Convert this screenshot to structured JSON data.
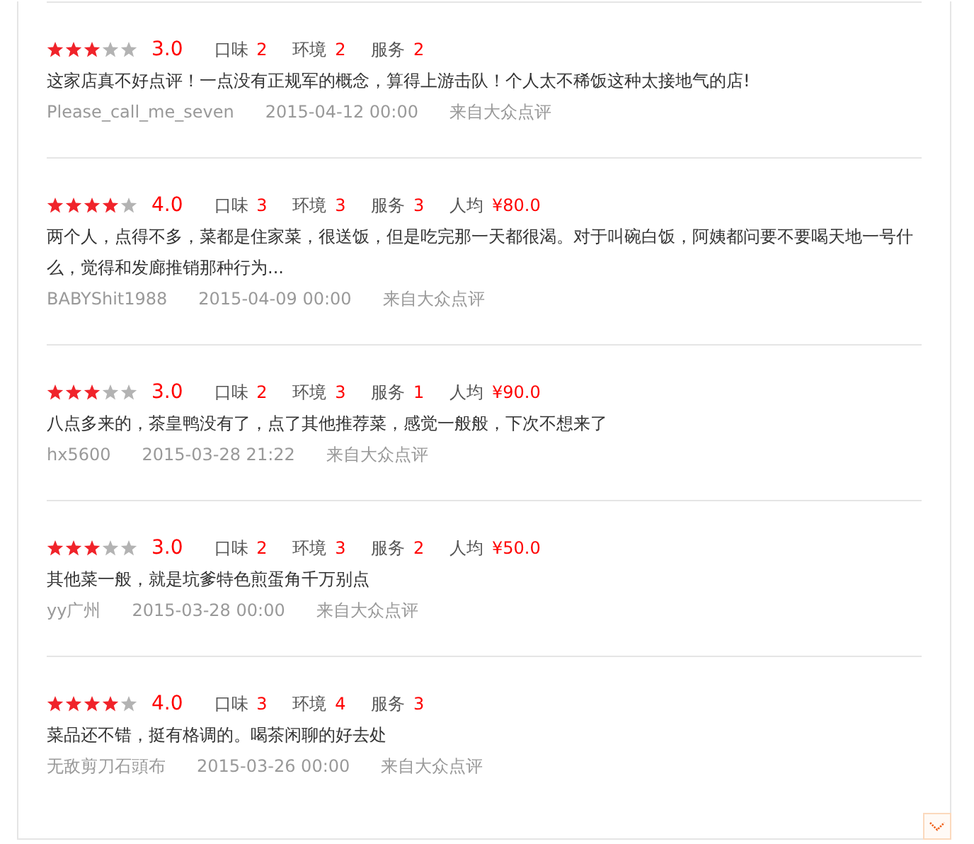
{
  "reviews": [
    {
      "stars": 3,
      "score": "3.0",
      "ratings": [
        {
          "label": "口味",
          "value": "2"
        },
        {
          "label": "环境",
          "value": "2"
        },
        {
          "label": "服务",
          "value": "2"
        }
      ],
      "text": "这家店真不好点评！一点没有正规军的概念，算得上游击队！个人太不稀饭这种太接地气的店!",
      "user": "Please_call_me_seven",
      "time": "2015-04-12 00:00",
      "source": "来自大众点评"
    },
    {
      "stars": 4,
      "score": "4.0",
      "ratings": [
        {
          "label": "口味",
          "value": "3"
        },
        {
          "label": "环境",
          "value": "3"
        },
        {
          "label": "服务",
          "value": "3"
        }
      ],
      "price": {
        "label": "人均",
        "value": "¥80.0"
      },
      "text": "两个人，点得不多，菜都是住家菜，很送饭，但是吃完那一天都很渴。对于叫碗白饭，阿姨都问要不要喝天地一号什么，觉得和发廊推销那种行为...",
      "user": "BABYShit1988",
      "time": "2015-04-09 00:00",
      "source": "来自大众点评"
    },
    {
      "stars": 3,
      "score": "3.0",
      "ratings": [
        {
          "label": "口味",
          "value": "2"
        },
        {
          "label": "环境",
          "value": "3"
        },
        {
          "label": "服务",
          "value": "1"
        }
      ],
      "price": {
        "label": "人均",
        "value": "¥90.0"
      },
      "text": "八点多来的，茶皇鸭没有了，点了其他推荐菜，感觉一般般，下次不想来了",
      "user": "hx5600",
      "time": "2015-03-28 21:22",
      "source": "来自大众点评"
    },
    {
      "stars": 3,
      "score": "3.0",
      "ratings": [
        {
          "label": "口味",
          "value": "2"
        },
        {
          "label": "环境",
          "value": "3"
        },
        {
          "label": "服务",
          "value": "2"
        }
      ],
      "price": {
        "label": "人均",
        "value": "¥50.0"
      },
      "text": "其他菜一般，就是坑爹特色煎蛋角千万别点",
      "user": "yy广州",
      "time": "2015-03-28 00:00",
      "source": "来自大众点评"
    },
    {
      "stars": 4,
      "score": "4.0",
      "ratings": [
        {
          "label": "口味",
          "value": "3"
        },
        {
          "label": "环境",
          "value": "4"
        },
        {
          "label": "服务",
          "value": "3"
        }
      ],
      "text": "菜品还不错，挺有格调的。喝茶闲聊的好去处",
      "user": "无敌剪刀石頭布",
      "time": "2015-03-26 00:00",
      "source": "来自大众点评"
    }
  ]
}
